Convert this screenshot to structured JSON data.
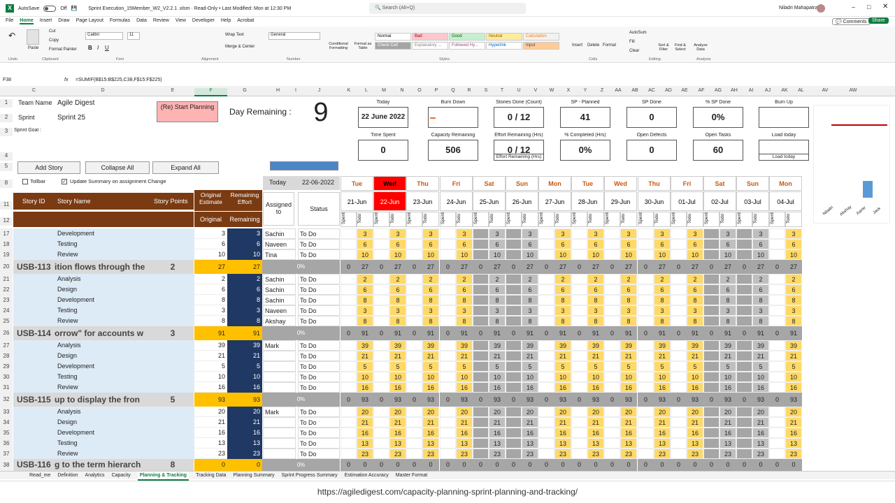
{
  "titlebar": {
    "autosave": "AutoSave",
    "autosave_state": "Off",
    "doc": "Sprint Execution_15Member_W2_V2.2.1 .xlsm  ·  Read-Only  •  Last Modified: Mon at 12:30 PM",
    "search": "Search (Alt+Q)",
    "user": "Niladri Mahapatra"
  },
  "menu": {
    "items": [
      "File",
      "Home",
      "Insert",
      "Draw",
      "Page Layout",
      "Formulas",
      "Data",
      "Review",
      "View",
      "Developer",
      "Help",
      "Acrobat"
    ],
    "comments": "Comments",
    "share": "Share"
  },
  "ribbon": {
    "cut": "Cut",
    "copy": "Copy",
    "paste": "Paste",
    "format_painter": "Format Painter",
    "font": "Calibri",
    "size": "11",
    "wrap": "Wrap Text",
    "merge": "Merge & Center",
    "numfmt": "General",
    "cond": "Conditional Formatting",
    "fmt_table": "Format as Table",
    "styles": [
      "Normal",
      "Bad",
      "Good",
      "Neutral",
      "Calculation",
      "Check Cell",
      "Explanatory ...",
      "Followed Hy...",
      "Hyperlink",
      "Input"
    ],
    "insert": "Insert",
    "delete": "Delete",
    "format": "Format",
    "autosum": "AutoSum",
    "fill": "Fill",
    "clear": "Clear",
    "sort": "Sort & Filter",
    "find": "Find & Select",
    "analyze": "Analyze Data",
    "groups": [
      "Undo",
      "Clipboard",
      "Font",
      "Alignment",
      "Number",
      "Styles",
      "Cells",
      "Editing",
      "Analysis"
    ]
  },
  "formula": {
    "namebox": "F38",
    "fx": "fx",
    "text": "=SUMIF(B$15:B$225,C38,F$15:F$225)"
  },
  "columns": [
    "C",
    "D",
    "E",
    "F",
    "G",
    "H",
    "I",
    "J",
    "K",
    "L",
    "M",
    "N",
    "O",
    "P",
    "Q",
    "R",
    "S",
    "T",
    "U",
    "V",
    "W",
    "X",
    "Y",
    "Z",
    "AA",
    "AB",
    "AC",
    "AD",
    "AE",
    "AF",
    "AG",
    "AH",
    "AI",
    "AJ",
    "AK",
    "AL",
    "AV",
    "AW"
  ],
  "header": {
    "team_label": "Team Name",
    "team": "Agile Digest",
    "sprint_label": "Sprint",
    "sprint": "Sprint 25",
    "goal_label": "Sprint Goal :",
    "restart": "(Re) Start Planning",
    "day_rem_label": "Day Remaining :",
    "day_rem": "9",
    "add_story": "Add Story",
    "collapse": "Collapse All",
    "expand": "Expand All",
    "tollbar": "Tollbar",
    "update_summary": "Update Summary on assignment Change",
    "today_label": "Today",
    "today": "22-06-2022"
  },
  "kpis": [
    {
      "label": "Today",
      "value": "22 June 2022"
    },
    {
      "label": "Burn Down",
      "value": ""
    },
    {
      "label": "Stories Done (Count)",
      "value": "0 / 12"
    },
    {
      "label": "SP - Planned",
      "value": "41"
    },
    {
      "label": "SP Done",
      "value": "0"
    },
    {
      "label": "% SP Done",
      "value": "0%"
    },
    {
      "label": "Burn Up",
      "value": ""
    },
    {
      "label": "Time Spent",
      "value": "0"
    },
    {
      "label": "Capacity Remaining",
      "value": "506"
    },
    {
      "label": "Effort Remaining (Hrs)",
      "value": "0 / 12"
    },
    {
      "label": "% Completed (Hrs)",
      "value": "0%"
    },
    {
      "label": "Open Defects",
      "value": "0"
    },
    {
      "label": "Open Tasks",
      "value": "60"
    },
    {
      "label": "Load today",
      "value": ""
    }
  ],
  "effort_sub": "Effort Remaining (Hrs)",
  "load_sub": "Load today",
  "load_chart": {
    "members": [
      "Niladri",
      "Akshay",
      "Aamir",
      "Jack"
    ],
    "values": [
      0,
      6,
      0,
      0
    ],
    "line": 8
  },
  "grid_headers": {
    "story_id": "Story ID",
    "story_name": "Story Name",
    "story_points": "Story Points",
    "orig_est": "Original Estimate",
    "rem_eff": "Remaining Effort",
    "assigned": "Assigned to",
    "status": "Status",
    "original": "Original",
    "remaining": "Remaining",
    "spent": "Spent",
    "todo": "Todo"
  },
  "days": [
    "Tue",
    "Wed",
    "Thu",
    "Fri",
    "Sat",
    "Sun",
    "Mon",
    "Tue",
    "Wed",
    "Thu",
    "Fri",
    "Sat",
    "Sun",
    "Mon"
  ],
  "dates": [
    "21-Jun",
    "22-Jun",
    "23-Jun",
    "24-Jun",
    "25-Jun",
    "26-Jun",
    "27-Jun",
    "28-Jun",
    "29-Jun",
    "30-Jun",
    "01-Jul",
    "02-Jul",
    "03-Jul",
    "04-Jul"
  ],
  "rows": [
    {
      "n": "17",
      "type": "task",
      "name": "Development",
      "orig": "3",
      "rem": "3",
      "who": "Sachin",
      "status": "To Do",
      "todo": "3"
    },
    {
      "n": "18",
      "type": "task",
      "name": "Testing",
      "orig": "6",
      "rem": "6",
      "who": "Naveen",
      "status": "To Do",
      "todo": "6"
    },
    {
      "n": "19",
      "type": "task",
      "name": "Review",
      "orig": "10",
      "rem": "10",
      "who": "Tina",
      "status": "To Do",
      "todo": "10"
    },
    {
      "n": "20",
      "type": "story",
      "id": "USB-113",
      "name": "ition flows through the",
      "sp": "2",
      "orig": "27",
      "rem": "27",
      "pct": "0%",
      "todo": "27"
    },
    {
      "n": "21",
      "type": "task",
      "name": "Analysis",
      "orig": "2",
      "rem": "2",
      "who": "Sachin",
      "status": "To Do",
      "todo": "2"
    },
    {
      "n": "22",
      "type": "task",
      "name": "Design",
      "orig": "6",
      "rem": "6",
      "who": "Sachin",
      "status": "To Do",
      "todo": "6"
    },
    {
      "n": "23",
      "type": "task",
      "name": "Development",
      "orig": "8",
      "rem": "8",
      "who": "Sachin",
      "status": "To Do",
      "todo": "8"
    },
    {
      "n": "24",
      "type": "task",
      "name": "Testing",
      "orig": "3",
      "rem": "3",
      "who": "Naveen",
      "status": "To Do",
      "todo": "3"
    },
    {
      "n": "25",
      "type": "task",
      "name": "Review",
      "orig": "8",
      "rem": "8",
      "who": "Akshay",
      "status": "To Do",
      "todo": "8"
    },
    {
      "n": "26",
      "type": "story",
      "id": "USB-114",
      "name": "orrow\" for accounts w",
      "sp": "3",
      "orig": "91",
      "rem": "91",
      "pct": "0%",
      "todo": "91"
    },
    {
      "n": "27",
      "type": "task",
      "name": "Analysis",
      "orig": "39",
      "rem": "39",
      "who": "Mark",
      "status": "To Do",
      "todo": "39"
    },
    {
      "n": "28",
      "type": "task",
      "name": "Design",
      "orig": "21",
      "rem": "21",
      "who": "",
      "status": "To Do",
      "todo": "21"
    },
    {
      "n": "29",
      "type": "task",
      "name": "Development",
      "orig": "5",
      "rem": "5",
      "who": "",
      "status": "To Do",
      "todo": "5"
    },
    {
      "n": "30",
      "type": "task",
      "name": "Testing",
      "orig": "10",
      "rem": "10",
      "who": "",
      "status": "To Do",
      "todo": "10"
    },
    {
      "n": "31",
      "type": "task",
      "name": "Review",
      "orig": "16",
      "rem": "16",
      "who": "",
      "status": "To Do",
      "todo": "16"
    },
    {
      "n": "32",
      "type": "story",
      "id": "USB-115",
      "name": "up to display the fron",
      "sp": "5",
      "orig": "93",
      "rem": "93",
      "pct": "0%",
      "todo": "93"
    },
    {
      "n": "33",
      "type": "task",
      "name": "Analysis",
      "orig": "20",
      "rem": "20",
      "who": "Mark",
      "status": "To Do",
      "todo": "20"
    },
    {
      "n": "34",
      "type": "task",
      "name": "Design",
      "orig": "21",
      "rem": "21",
      "who": "",
      "status": "To Do",
      "todo": "21"
    },
    {
      "n": "35",
      "type": "task",
      "name": "Development",
      "orig": "16",
      "rem": "16",
      "who": "",
      "status": "To Do",
      "todo": "16"
    },
    {
      "n": "36",
      "type": "task",
      "name": "Testing",
      "orig": "13",
      "rem": "13",
      "who": "",
      "status": "To Do",
      "todo": "13"
    },
    {
      "n": "37",
      "type": "task",
      "name": "Review",
      "orig": "23",
      "rem": "23",
      "who": "",
      "status": "To Do",
      "todo": "23"
    },
    {
      "n": "38",
      "type": "story",
      "id": "USB-116",
      "name": "g to the term hierarch",
      "sp": "8",
      "orig": "0",
      "rem": "0",
      "pct": "0%",
      "todo": "0"
    }
  ],
  "sheet_tabs": [
    "Read_me",
    "Definition",
    "Analytics",
    "Capacity",
    "Planning & Tracking",
    "Tracking Data",
    "Planning Summary",
    "Sprint Progress Summary",
    "Estimation Accuracy",
    "Master Format"
  ],
  "active_tab": "Planning & Tracking",
  "url": "https://agiledigest.com/capacity-planning-sprint-planning-and-tracking/",
  "colors": {
    "brown": "#7a3a12",
    "navy": "#1f3864",
    "yellow": "#ffd966",
    "red": "#ff0000",
    "green": "#107c41"
  }
}
